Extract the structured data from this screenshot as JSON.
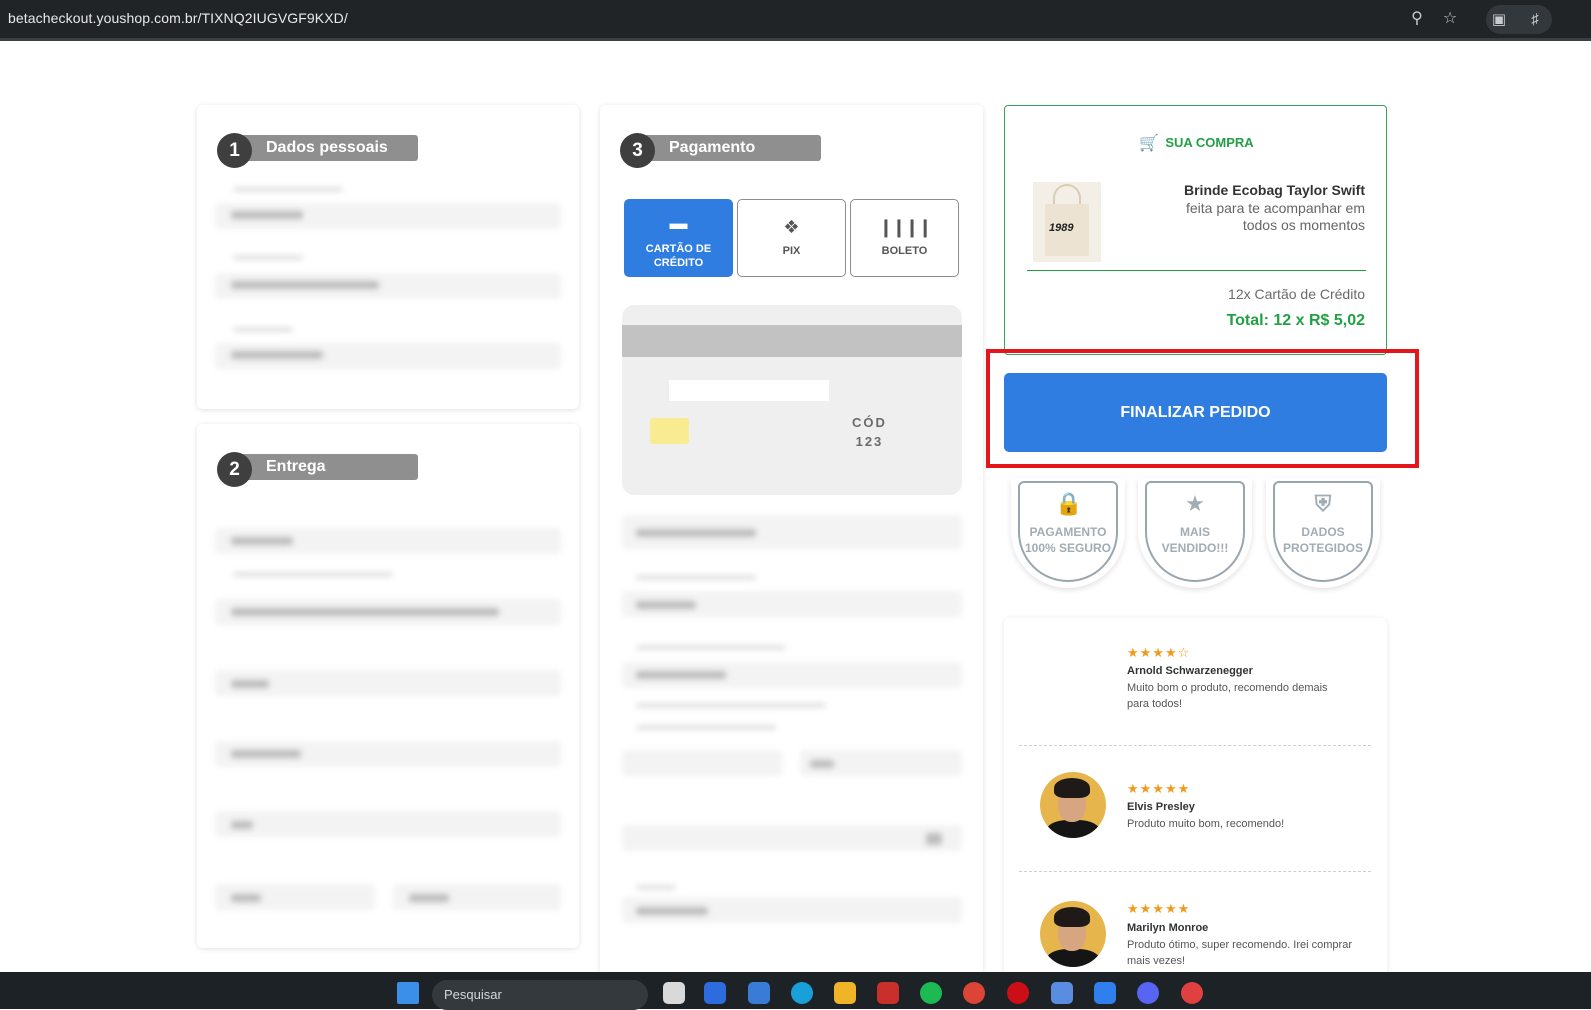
{
  "browser": {
    "url": "betacheckout.youshop.com.br/TIXNQ2IUGVGF9KXD/",
    "icons": [
      "zoom-icon",
      "bookmark-star-icon",
      "screen-capture-icon",
      "extensions-icon"
    ]
  },
  "steps": {
    "personal": {
      "number": "1",
      "label": "Dados pessoais"
    },
    "delivery": {
      "number": "2",
      "label": "Entrega"
    },
    "payment": {
      "number": "3",
      "label": "Pagamento"
    }
  },
  "payment_methods": [
    {
      "label": "CARTÃO DE CRÉDITO",
      "icon": "credit-card-icon",
      "active": true
    },
    {
      "label": "PIX",
      "icon": "pix-icon",
      "active": false
    },
    {
      "label": "BOLETO",
      "icon": "barcode-icon",
      "active": false
    }
  ],
  "card_preview": {
    "cod_label": "CÓD",
    "cod_value": "123"
  },
  "summary": {
    "heading": "SUA COMPRA",
    "product_title": "Brinde Ecobag Taylor Swift",
    "product_desc": "feita para te acompanhar em todos os momentos",
    "product_image_text": "1989",
    "installments": "12x Cartão de Crédito",
    "total": "Total: 12 x R$ 5,02"
  },
  "finalize_label": "FINALIZAR PEDIDO",
  "badges": [
    {
      "label": "PAGAMENTO 100% SEGURO",
      "icon": "lock-shield-icon"
    },
    {
      "label": "MAIS VENDIDO!!!",
      "icon": "star-icon"
    },
    {
      "label": "DADOS PROTEGIDOS",
      "icon": "shield-check-icon"
    }
  ],
  "reviews": [
    {
      "stars": "★★★★☆",
      "rating": 4,
      "name": "Arnold Schwarzenegger",
      "text": "Muito bom o produto, recomendo demais para todos!"
    },
    {
      "stars": "★★★★★",
      "rating": 5,
      "name": "Elvis Presley",
      "text": "Produto muito bom, recomendo!"
    },
    {
      "stars": "★★★★★",
      "rating": 5,
      "name": "Marilyn Monroe",
      "text": "Produto ótimo, super recomendo. Irei comprar mais vezes!"
    }
  ],
  "taskbar": {
    "search_placeholder": "Pesquisar"
  },
  "colors": {
    "accent_blue": "#2f7de1",
    "success_green": "#23a045",
    "highlight_red": "#e3161b",
    "step_gray": "#8f8f8f",
    "star_orange": "#f29a1b"
  }
}
